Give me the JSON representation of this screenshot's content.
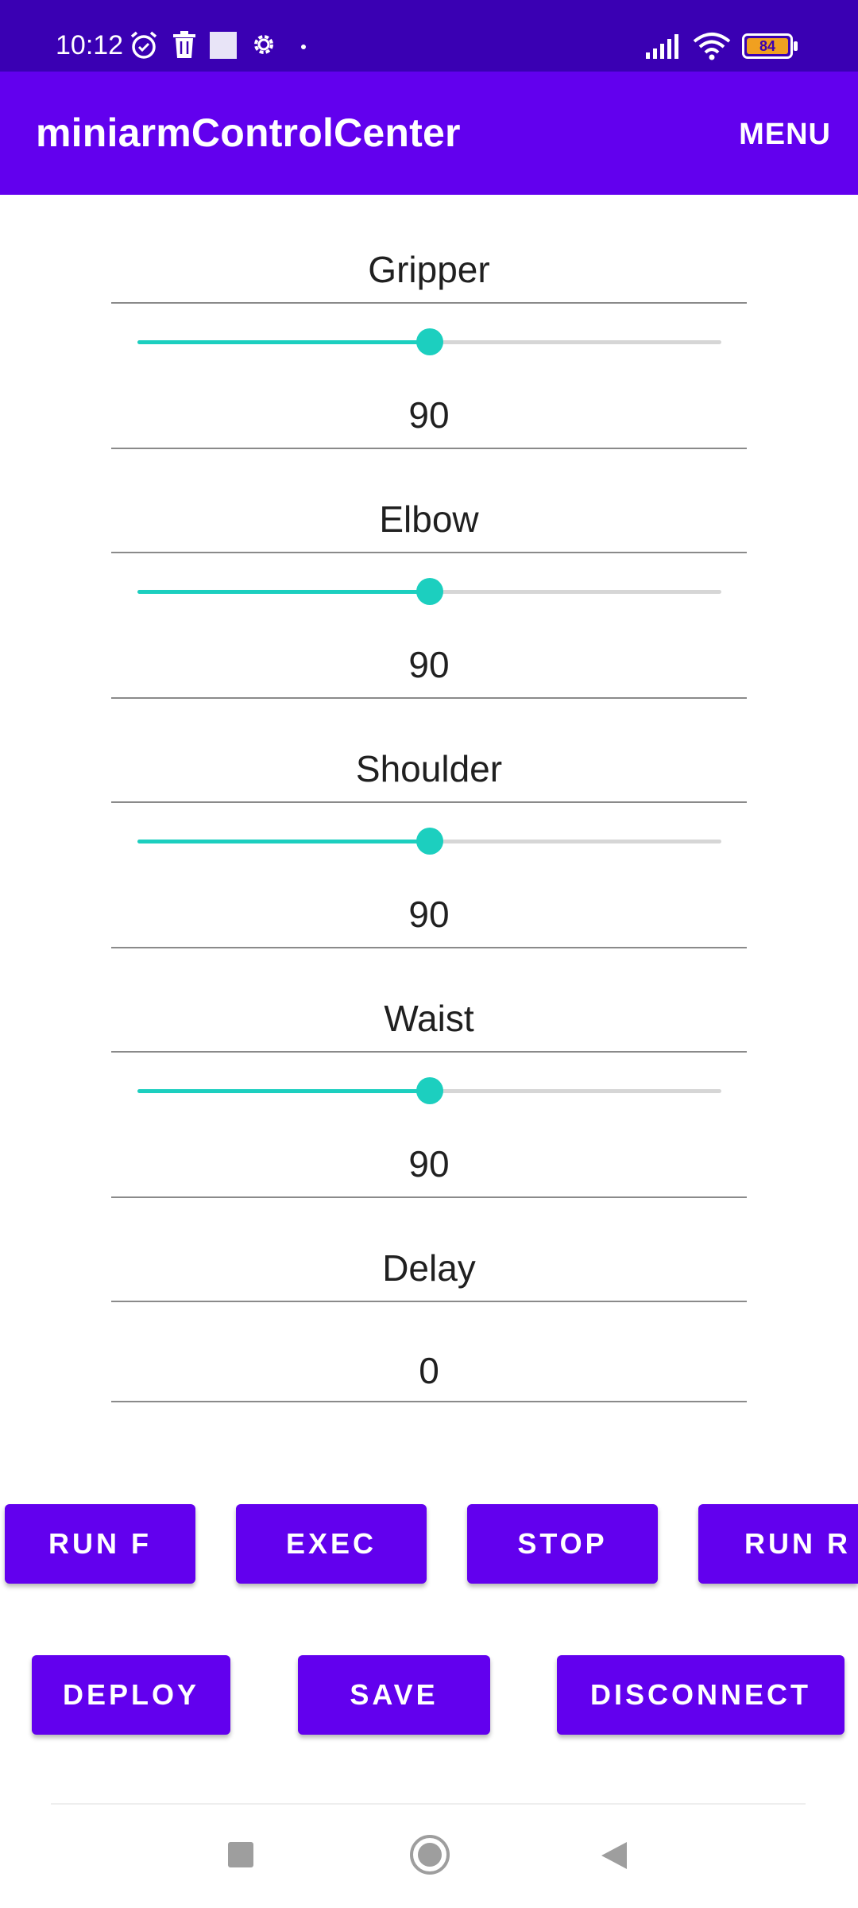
{
  "status_bar": {
    "time": "10:12",
    "battery": "84",
    "icons": [
      "alarm-icon",
      "trash-icon",
      "square-icon",
      "gear-icon",
      "dot-icon",
      "signal-icon",
      "wifi-icon",
      "battery-icon"
    ]
  },
  "app_bar": {
    "title": "miniarmControlCenter",
    "menu_label": "MENU"
  },
  "controls": [
    {
      "label": "Gripper",
      "value": "90",
      "slider_fraction": 0.5
    },
    {
      "label": "Elbow",
      "value": "90",
      "slider_fraction": 0.5
    },
    {
      "label": "Shoulder",
      "value": "90",
      "slider_fraction": 0.5
    },
    {
      "label": "Waist",
      "value": "90",
      "slider_fraction": 0.5
    }
  ],
  "delay": {
    "label": "Delay",
    "value": "0"
  },
  "buttons_row1": [
    "RUN F",
    "EXEC",
    "STOP",
    "RUN R"
  ],
  "buttons_row2": [
    "DEPLOY",
    "SAVE",
    "DISCONNECT"
  ],
  "nav_bar": {
    "icons": [
      "recents-icon",
      "home-icon",
      "back-icon"
    ]
  },
  "colors": {
    "status_bar": "#3a00b3",
    "app_bar": "#6200ee",
    "button": "#6200ee",
    "slider_accent": "#1ccfbf"
  }
}
